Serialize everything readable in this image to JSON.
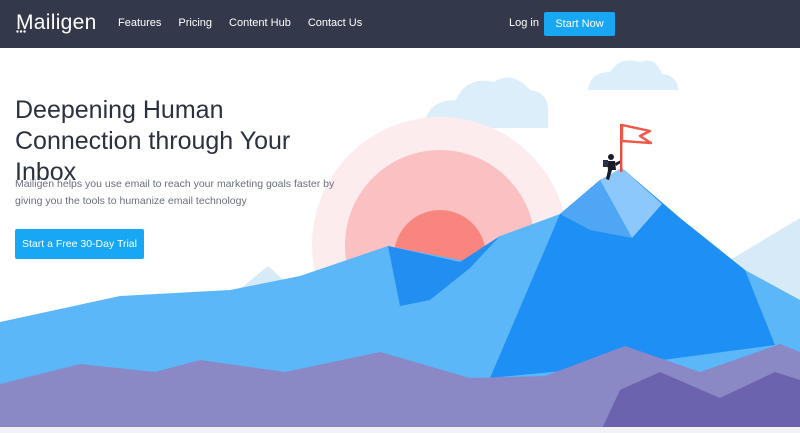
{
  "brand": {
    "name": "Mailigen"
  },
  "nav": {
    "links": [
      "Features",
      "Pricing",
      "Content Hub",
      "Contact Us"
    ],
    "login_label": "Log in",
    "start_label": "Start Now"
  },
  "hero": {
    "headline": "Deepening Human Connection through Your Inbox",
    "subtext": "Mailigen helps you use email to reach your marketing goals faster by giving you the tools to humanize email technology",
    "cta_label": "Start a Free 30-Day Trial"
  },
  "colors": {
    "nav_bg": "#33394a",
    "accent": "#18a7f5",
    "heading": "#2c3140",
    "body_text": "#6a6f7b",
    "flag": "#f0584a"
  },
  "illustration": {
    "icons": [
      "cloud-icon",
      "sun-icon",
      "mountain-icon",
      "climber-icon",
      "flag-icon"
    ]
  }
}
